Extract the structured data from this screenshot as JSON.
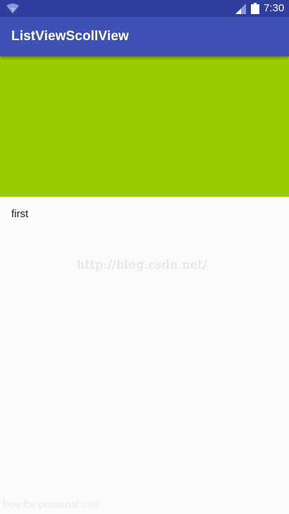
{
  "status_bar": {
    "time": "7:30",
    "icons": [
      "wifi-icon",
      "signal-icon",
      "battery-icon"
    ]
  },
  "app_bar": {
    "title": "ListViewScollView",
    "color": "#3f51b5"
  },
  "header_block": {
    "color": "#99cc00"
  },
  "list": {
    "items": [
      {
        "label": "first"
      }
    ]
  },
  "watermark": "http://blog.csdn.net/",
  "footer_note": "free for personal use"
}
